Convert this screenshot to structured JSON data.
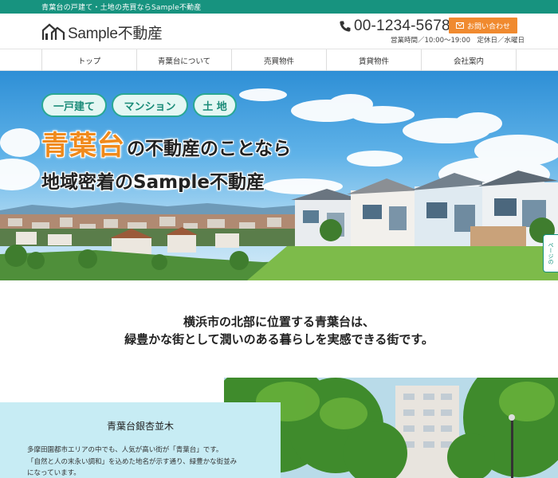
{
  "topbar": {
    "text": "青葉台の戸建て・土地の売買ならSample不動産"
  },
  "header": {
    "logo_text": "Sample不動産",
    "phone": "00-1234-5678",
    "hours": "営業時間／10:00～19:00　定休日／水曜日",
    "contact_label": "お問い合わせ"
  },
  "nav": {
    "items": [
      "トップ",
      "青葉台について",
      "売買物件",
      "賃貸物件",
      "会社案内"
    ]
  },
  "hero": {
    "pills": [
      "一戸建て",
      "マンション",
      "土 地"
    ],
    "headline_highlight": "青葉台",
    "headline_rest": "の不動産のことなら",
    "headline2": "地域密着のSample不動産",
    "side_tab": "ページの"
  },
  "intro": {
    "line1": "横浜市の北部に位置する青葉台は、",
    "line2": "緑豊かな街として潤いのある暮らしを実感できる街です。"
  },
  "feature": {
    "title": "青葉台銀杏並木",
    "lines": [
      "多摩田園都市エリアの中でも、人気が高い街が「青葉台」です。",
      "「自然と人の末永い調和」を込めた地名が示す通り、緑豊かな街並み",
      "になっています。"
    ]
  },
  "colors": {
    "brand": "#17937f",
    "accent": "#f08a2f",
    "highlight": "#f08a1c",
    "info_bg": "#c7ecf4"
  }
}
